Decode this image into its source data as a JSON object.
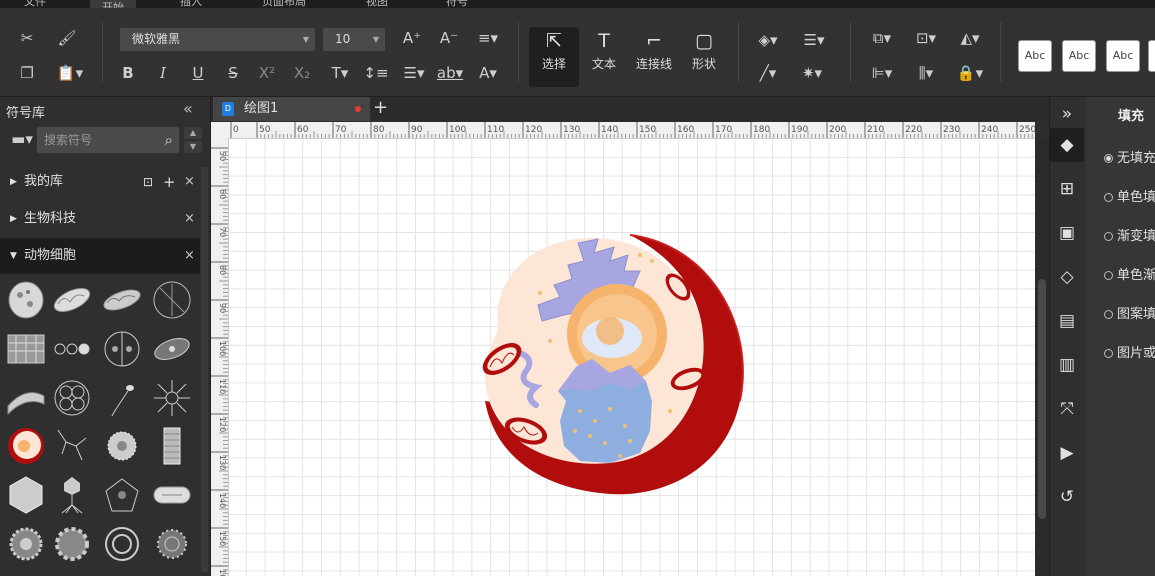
{
  "menubar": {
    "items": [
      "文件",
      "开始",
      "插入",
      "页面布局",
      "视图",
      "符号"
    ],
    "active": "开始"
  },
  "toolbar": {
    "font_name": "微软雅黑",
    "font_size": "10",
    "tools": [
      {
        "label": "选择"
      },
      {
        "label": "文本"
      },
      {
        "label": "连接线"
      },
      {
        "label": "形状"
      }
    ],
    "style_samples": [
      "Abc",
      "Abc",
      "Abc"
    ]
  },
  "symbol_library": {
    "title": "符号库",
    "search_placeholder": "搜索符号",
    "libraries": [
      {
        "label": "我的库"
      },
      {
        "label": "生物科技"
      },
      {
        "label": "动物细胞"
      }
    ]
  },
  "document": {
    "tab_label": "绘图1",
    "ruler_h": [
      "0",
      "50",
      "60",
      "70",
      "80",
      "90",
      "100",
      "110",
      "120",
      "130",
      "140",
      "150",
      "160",
      "170",
      "180",
      "190",
      "200",
      "210",
      "220",
      "230",
      "240",
      "250"
    ],
    "ruler_v": [
      "50",
      "60",
      "70",
      "80",
      "90",
      "100",
      "110",
      "120",
      "130",
      "140",
      "150",
      "160"
    ]
  },
  "fill_panel": {
    "title": "填充",
    "options": [
      "无填充",
      "单色填充",
      "渐变填充",
      "单色渐变填充",
      "图案填充",
      "图片或纹理填充"
    ],
    "selected": "无填充"
  },
  "colors": {
    "selected_tool_bg": "#1f1f1f",
    "cell_membrane": "#b10d0d",
    "cytoplasm": "#fde6d6",
    "nucleus": "#f5b36b",
    "er_blue": "#a7a6e0",
    "tab_modified_dot": "#e03a3a"
  }
}
